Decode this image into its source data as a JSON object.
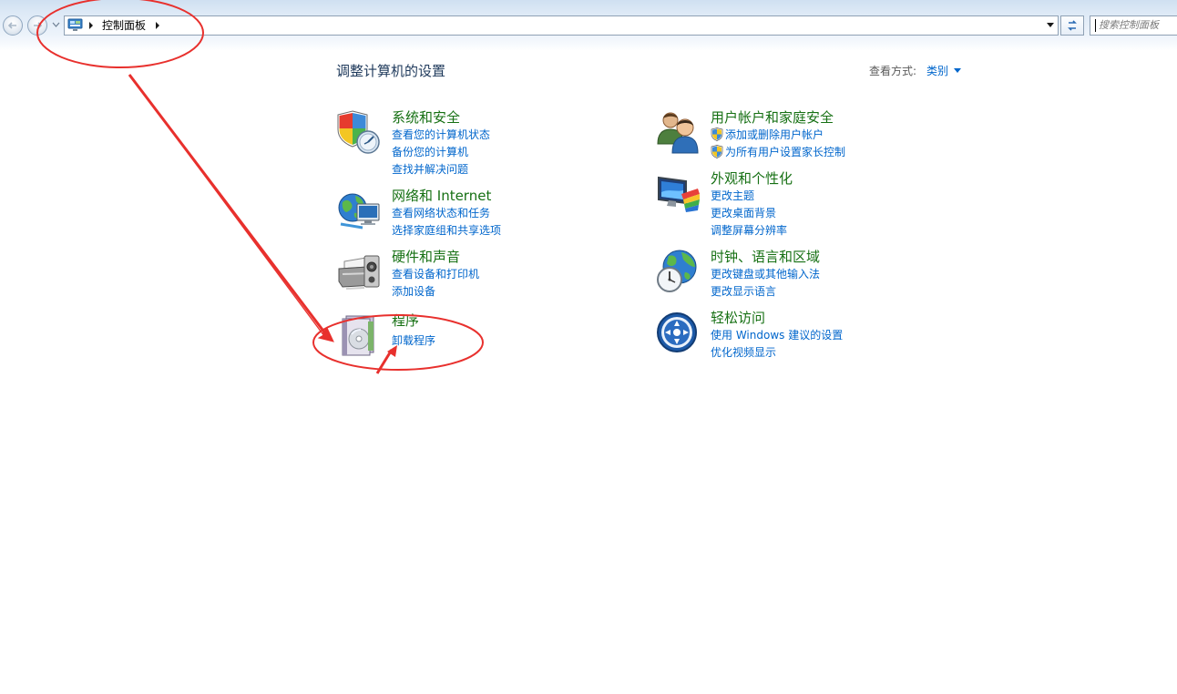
{
  "breadcrumb": {
    "items": [
      "控制面板"
    ]
  },
  "search": {
    "placeholder": "搜索控制面板"
  },
  "main": {
    "title": "调整计算机的设置",
    "view_by_label": "查看方式:",
    "view_by_value": "类别"
  },
  "categories": [
    {
      "title": "系统和安全",
      "icon": "shield-security-icon",
      "links": [
        "查看您的计算机状态",
        "备份您的计算机",
        "查找并解决问题"
      ]
    },
    {
      "title": "网络和 Internet",
      "icon": "network-globe-icon",
      "links": [
        "查看网络状态和任务",
        "选择家庭组和共享选项"
      ]
    },
    {
      "title": "硬件和声音",
      "icon": "printer-speaker-icon",
      "links": [
        "查看设备和打印机",
        "添加设备"
      ]
    },
    {
      "title": "程序",
      "icon": "programs-disc-icon",
      "links": [
        "卸载程序"
      ]
    },
    {
      "title": "用户帐户和家庭安全",
      "icon": "users-icon",
      "links": [
        "添加或删除用户帐户",
        "为所有用户设置家长控制"
      ]
    },
    {
      "title": "外观和个性化",
      "icon": "monitor-palette-icon",
      "links": [
        "更改主题",
        "更改桌面背景",
        "调整屏幕分辨率"
      ]
    },
    {
      "title": "时钟、语言和区域",
      "icon": "clock-globe-icon",
      "links": [
        "更改键盘或其他输入法",
        "更改显示语言"
      ]
    },
    {
      "title": "轻松访问",
      "icon": "ease-of-access-icon",
      "links": [
        "使用 Windows 建议的设置",
        "优化视频显示"
      ]
    }
  ],
  "colors": {
    "category_title": "#167013",
    "link": "#0066cc",
    "heading": "#1e395b",
    "annotation": "#e8302d"
  }
}
